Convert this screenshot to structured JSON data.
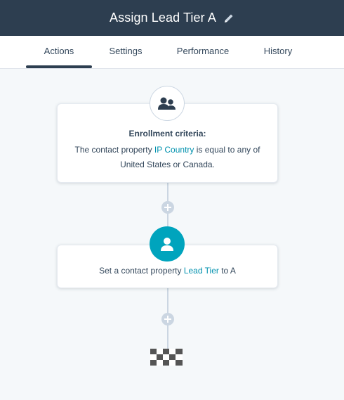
{
  "header": {
    "title": "Assign Lead Tier A",
    "edit_icon": "pencil-icon"
  },
  "tabs": [
    {
      "label": "Actions",
      "active": true
    },
    {
      "label": "Settings",
      "active": false
    },
    {
      "label": "Performance",
      "active": false
    },
    {
      "label": "History",
      "active": false
    }
  ],
  "enrollment": {
    "icon": "contacts-icon",
    "title": "Enrollment criteria:",
    "text_before": "The contact property ",
    "property": "IP Country",
    "text_middle": " is equal to any of",
    "value_1": "United States",
    "text_or": " or ",
    "value_2": "Canada",
    "text_end": "."
  },
  "action": {
    "icon": "contact-icon",
    "text_before": "Set a contact property ",
    "property": "Lead Tier",
    "text_after": " to A"
  },
  "colors": {
    "header_bg": "#2d3e50",
    "accent_teal": "#00a4bd",
    "link": "#0091ae",
    "connector": "#cbd6e2"
  }
}
